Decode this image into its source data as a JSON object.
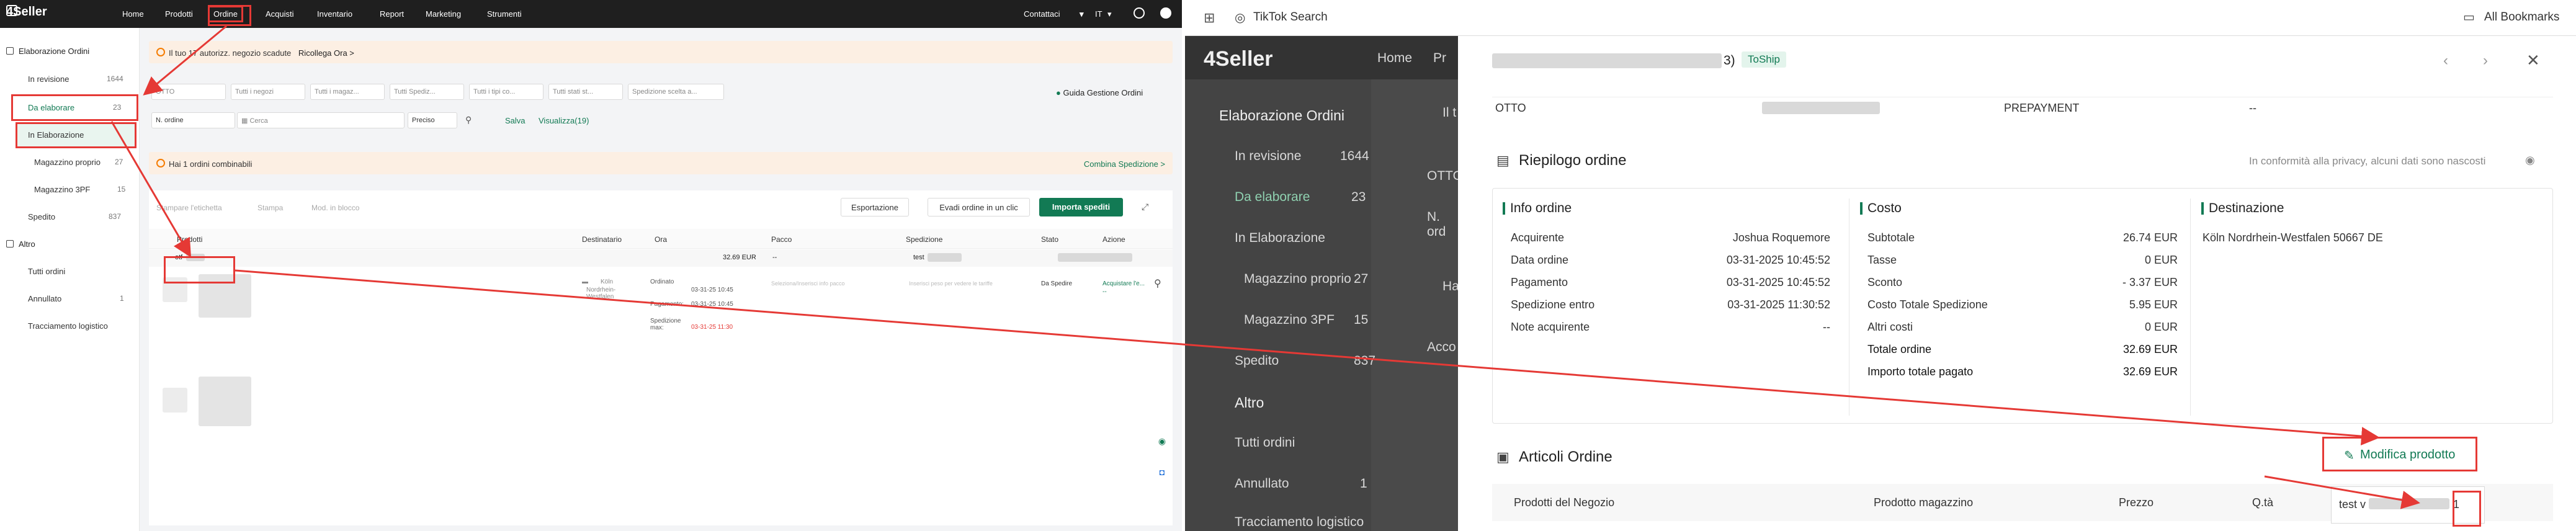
{
  "left": {
    "logo": "4Seller",
    "nav": [
      "Home",
      "Prodotti",
      "Ordine",
      "Acquisti",
      "Inventario",
      "Report",
      "Marketing",
      "Strumenti"
    ],
    "topright": {
      "contacts": "Contattaci",
      "lang": "IT"
    },
    "sidebar": {
      "group_orders": "Elaborazione Ordini",
      "items": [
        {
          "label": "In revisione",
          "count": "1644"
        },
        {
          "label": "Da elaborare",
          "count": "23"
        },
        {
          "label": "In Elaborazione",
          "count": ""
        },
        {
          "label": "Magazzino proprio",
          "count": "27"
        },
        {
          "label": "Magazzino 3PF",
          "count": "15"
        },
        {
          "label": "Spedito",
          "count": "837"
        }
      ],
      "group_other": "Altro",
      "other_items": [
        {
          "label": "Tutti ordini",
          "count": ""
        },
        {
          "label": "Annullato",
          "count": "1"
        },
        {
          "label": "Tracciamento logistico",
          "count": ""
        }
      ]
    },
    "banner1": {
      "text": "Il tuo 17 autorizz. negozio scadute",
      "link": "Ricollega Ora >"
    },
    "filters": [
      "OTTO",
      "Tutti i negozi",
      "Tutti i magaz...",
      "Tutti Spediz...",
      "Tutti i tipi co...",
      "Tutti stati st...",
      "Spedizione scelta a..."
    ],
    "guide": "Guida Gestione Ordini",
    "search": {
      "field": "N. ordine",
      "placeholder": "Cerca",
      "mode": "Preciso",
      "save": "Salva",
      "view": "Visualizza(19)"
    },
    "banner2": {
      "text": "Hai 1 ordini combinabili",
      "link": "Combina Spedizione >"
    },
    "toolbar": {
      "print_label": "Stampare l'etichetta",
      "print": "Stampa",
      "mod": "Mod. in blocco",
      "export": "Esportazione",
      "ship_click": "Evadi ordine in un clic",
      "import": "Importa spediti"
    },
    "table_headers": [
      "Prodotti",
      "Destinatario",
      "Ora",
      "Pacco",
      "Spedizione",
      "Stato",
      "Azione"
    ],
    "row": {
      "order_no": "otf",
      "total": "32.69 EUR",
      "dash": "--",
      "ship_text": "test",
      "country": "Köln",
      "region": "Nordrhein-Westfalen",
      "ordered_label": "Ordinato",
      "ordered_date": "03-31-25 10:45",
      "paid_label": "Pagamento:",
      "paid_date": "03-31-25 10:45",
      "ship_by_label": "Spedizione max:",
      "ship_by_date": "03-31-25 11:30",
      "pkg_hint": "Seleziona/Inserisci info pacco",
      "ship_hint": "Inserisci peso per vedere le tariffe",
      "status": "Da Spedire",
      "action": "Acquistare l'e..."
    }
  },
  "right": {
    "bookmark": {
      "search": "TikTok Search",
      "all": "All Bookmarks"
    },
    "bg": {
      "logo": "4Seller",
      "home": "Home",
      "pr": "Pr",
      "group": "Elaborazione Ordini",
      "items": [
        {
          "label": "In revisione",
          "count": "1644"
        },
        {
          "label": "Da elaborare",
          "count": "23"
        },
        {
          "label": "In Elaborazione",
          "count": ""
        },
        {
          "label": "Magazzino proprio",
          "count": "27"
        },
        {
          "label": "Magazzino 3PF",
          "count": "15"
        },
        {
          "label": "Spedito",
          "count": "837"
        }
      ],
      "altro": "Altro",
      "other": [
        {
          "label": "Tutti ordini",
          "count": ""
        },
        {
          "label": "Annullato",
          "count": "1"
        },
        {
          "label": "Tracciamento logistico",
          "count": ""
        }
      ],
      "frag_il": "Il t",
      "frag_otto": "OTTO",
      "frag_n": "N. ord",
      "frag_ha": "Ha",
      "frag_acc": "Acco"
    },
    "drawer": {
      "order_suffix": "3)",
      "status": "ToShip",
      "store": "OTTO",
      "pay_type": "PREPAYMENT",
      "pay_dash": "--",
      "summary_title": "Riepilogo ordine",
      "privacy": "In conformità alla privacy, alcuni dati sono nascosti",
      "info_title": "Info ordine",
      "info": [
        {
          "k": "Acquirente",
          "v": "Joshua Roquemore"
        },
        {
          "k": "Data ordine",
          "v": "03-31-2025 10:45:52"
        },
        {
          "k": "Pagamento",
          "v": "03-31-2025 10:45:52"
        },
        {
          "k": "Spedizione entro",
          "v": "03-31-2025 11:30:52"
        },
        {
          "k": "Note acquirente",
          "v": "--"
        }
      ],
      "cost_title": "Costo",
      "cost": [
        {
          "k": "Subtotale",
          "v": "26.74 EUR"
        },
        {
          "k": "Tasse",
          "v": "0 EUR"
        },
        {
          "k": "Sconto",
          "v": "- 3.37 EUR"
        },
        {
          "k": "Costo Totale Spedizione",
          "v": "5.95 EUR"
        },
        {
          "k": "Altri costi",
          "v": "0 EUR"
        },
        {
          "k": "Totale ordine",
          "v": "32.69 EUR"
        },
        {
          "k": "Importo totale pagato",
          "v": "32.69 EUR"
        }
      ],
      "dest_title": "Destinazione",
      "dest": "Köln Nordrhein-Westfalen 50667 DE",
      "items_title": "Articoli Ordine",
      "modify": "Modifica prodotto",
      "cols": [
        "Prodotti del Negozio",
        "Prodotto magazzino",
        "Prezzo",
        "Q.tà"
      ],
      "item_text": "test v",
      "item_qty": "1"
    }
  },
  "colors": {
    "brand": "#127a54",
    "annot": "#e53935"
  }
}
